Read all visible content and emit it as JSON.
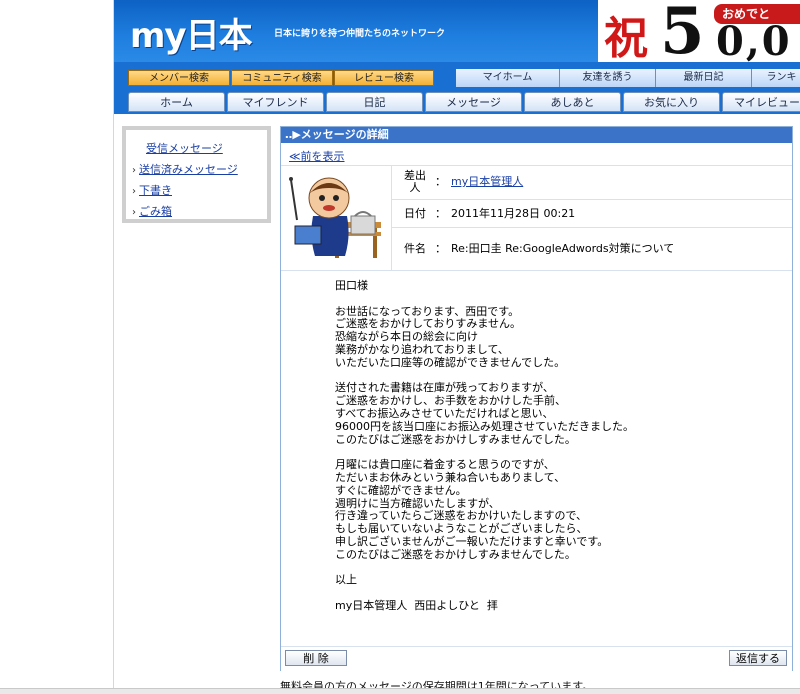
{
  "header": {
    "logo_my": "my",
    "logo_nihon": "日本",
    "tagline": "日本に誇りを持つ仲間たちのネットワーク",
    "banner": {
      "iwai": "祝",
      "number": "5",
      "tail": "0,0",
      "omedeto": "おめでと"
    }
  },
  "nav_row1": {
    "search_tabs": [
      "メンバー検索",
      "コミュニティ検索",
      "レビュー検索"
    ],
    "menu_tabs": [
      "マイホーム",
      "友達を誘う",
      "最新日記",
      "ランキ"
    ]
  },
  "nav_row2": {
    "tabs": [
      "ホーム",
      "マイフレンド",
      "日記",
      "メッセージ",
      "あしあと",
      "お気に入り",
      "マイレビュー"
    ]
  },
  "sidebar": {
    "items": [
      {
        "label": "受信メッセージ",
        "arrow": ""
      },
      {
        "label": "送信済みメッセージ",
        "arrow": "›"
      },
      {
        "label": "下書き",
        "arrow": "›"
      },
      {
        "label": "ごみ箱",
        "arrow": "›"
      }
    ]
  },
  "message": {
    "panel_title": "‥▶メッセージの詳細",
    "prev_link": "≪前を表示",
    "from_label": "差出人",
    "from_value": "my日本管理人",
    "date_label": "日付",
    "date_value": "2011年11月28日 00:21",
    "subject_label": "件名",
    "subject_value": "Re:田口圭  Re:GoogleAdwords対策について",
    "colon": "：",
    "body_lines": [
      "田口様",
      "",
      "お世話になっております、西田です。",
      "ご迷惑をおかけしておりすみません。",
      "恐縮ながら本日の総会に向け",
      "業務がかなり追われておりまして、",
      "いただいた口座等の確認ができませんでした。",
      "",
      "送付された書籍は在庫が残っておりますが、",
      "ご迷惑をおかけし、お手数をおかけした手前、",
      "すべてお振込みさせていただければと思い、",
      "96000円を該当口座にお振込み処理させていただきました。",
      "このたびはご迷惑をおかけしすみませんでした。",
      "",
      "月曜には貴口座に着金すると思うのですが、",
      "ただいまお休みという兼ね合いもありまして、",
      "すぐに確認ができません。",
      "週明けに当方確認いたしますが、",
      "行き違っていたらご迷惑をおかけいたしますので、",
      "もしも届いていないようなことがございましたら、",
      "申し訳ございませんがご一報いただけますと幸いです。",
      "このたびはご迷惑をおかけしすみませんでした。",
      "",
      "以上",
      "",
      "my日本管理人  西田よしひと  拝"
    ],
    "delete_button": "削 除",
    "reply_button": "返信する"
  },
  "footer_note": "無料会員の方のメッセージの保存期間は1年間になっています。"
}
